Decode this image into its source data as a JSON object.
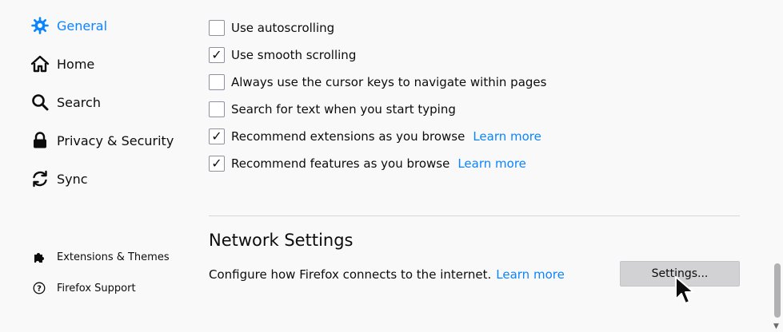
{
  "sidebar": {
    "items": [
      {
        "label": "General",
        "icon": "gear-icon",
        "active": true
      },
      {
        "label": "Home",
        "icon": "home-icon"
      },
      {
        "label": "Search",
        "icon": "search-icon"
      },
      {
        "label": "Privacy & Security",
        "icon": "lock-icon"
      },
      {
        "label": "Sync",
        "icon": "sync-icon"
      }
    ],
    "footer_items": [
      {
        "label": "Extensions & Themes",
        "icon": "puzzle-icon"
      },
      {
        "label": "Firefox Support",
        "icon": "help-icon"
      }
    ]
  },
  "browsing": {
    "options": [
      {
        "label": "Use autoscrolling",
        "checked": false
      },
      {
        "label": "Use smooth scrolling",
        "checked": true
      },
      {
        "label": "Always use the cursor keys to navigate within pages",
        "checked": false
      },
      {
        "label": "Search for text when you start typing",
        "checked": false
      },
      {
        "label": "Recommend extensions as you browse",
        "checked": true,
        "link": "Learn more"
      },
      {
        "label": "Recommend features as you browse",
        "checked": true,
        "link": "Learn more"
      }
    ]
  },
  "network": {
    "title": "Network Settings",
    "description": "Configure how Firefox connects to the internet.",
    "link": "Learn more",
    "button_label": "Settings..."
  },
  "colors": {
    "accent": "#0a84ff",
    "button_bg": "#d2d2d5"
  }
}
